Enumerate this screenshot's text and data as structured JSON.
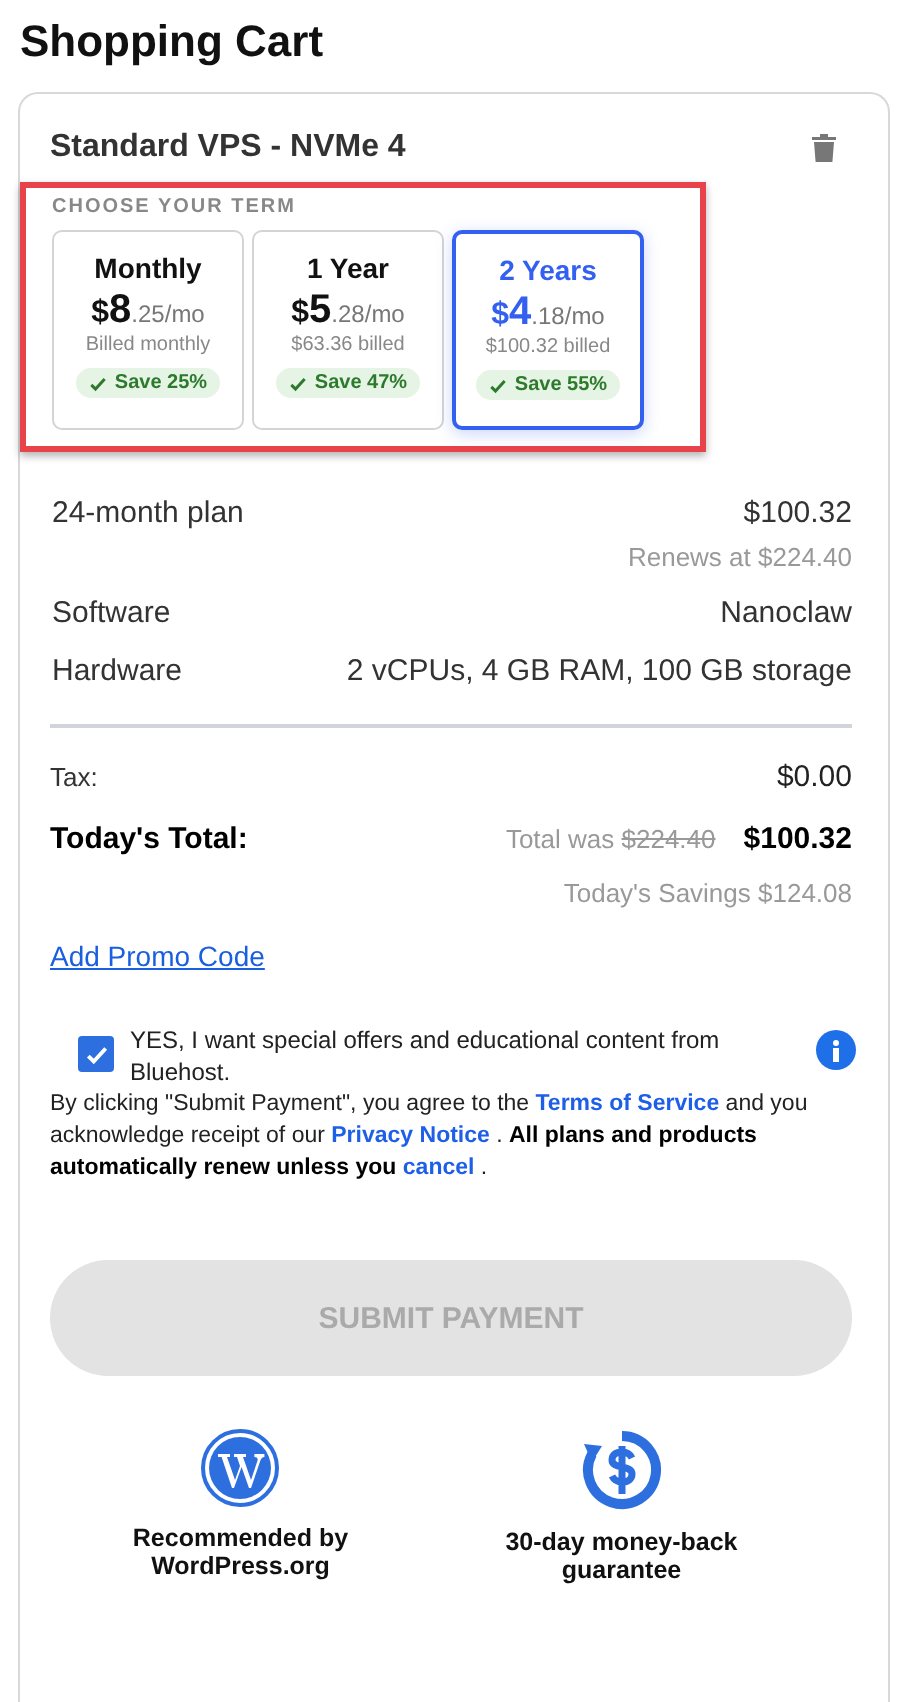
{
  "title": "Shopping Cart",
  "item": {
    "name": "Standard VPS - NVMe 4",
    "term_heading": "CHOOSE YOUR TERM",
    "terms": [
      {
        "label": "Monthly",
        "currency": "$",
        "whole": "8",
        "fraction": ".25/mo",
        "billed": "Billed monthly",
        "save": "Save 25%",
        "selected": false
      },
      {
        "label": "1 Year",
        "currency": "$",
        "whole": "5",
        "fraction": ".28/mo",
        "billed": "$63.36 billed",
        "save": "Save 47%",
        "selected": false
      },
      {
        "label": "2 Years",
        "currency": "$",
        "whole": "4",
        "fraction": ".18/mo",
        "billed": "$100.32 billed",
        "save": "Save 55%",
        "selected": true
      }
    ],
    "details": [
      {
        "label": "24-month plan",
        "value": "$100.32",
        "note": "Renews at $224.40"
      },
      {
        "label": "Software",
        "value": "Nanoclaw"
      },
      {
        "label": "Hardware",
        "value": "2 vCPUs, 4 GB RAM, 100 GB storage"
      }
    ]
  },
  "tax": {
    "label": "Tax:",
    "value": "$0.00"
  },
  "total": {
    "label": "Today's Total:",
    "was_label": "Total was",
    "was_value": "$224.40",
    "value": "$100.32",
    "savings": "Today's Savings $124.08"
  },
  "promo_link": "Add Promo Code",
  "offers": {
    "checked": true,
    "label": "YES, I want special offers and educational content from Bluehost."
  },
  "legal": [
    {
      "kind": "plain",
      "text": "By clicking \"Submit Payment\", you agree to the "
    },
    {
      "kind": "link",
      "text": "Terms of Service"
    },
    {
      "kind": "plain",
      "text": " and you acknowledge receipt of our "
    },
    {
      "kind": "link",
      "text": "Privacy Notice"
    },
    {
      "kind": "plain",
      "text": " . "
    },
    {
      "kind": "bold",
      "text": "All plans and products automatically renew unless you "
    },
    {
      "kind": "link",
      "text": "cancel"
    },
    {
      "kind": "plain",
      "text": " ."
    }
  ],
  "submit": {
    "label": "SUBMIT PAYMENT",
    "disabled": true
  },
  "badges": [
    {
      "kind": "wordpress",
      "text": "Recommended by WordPress.org"
    },
    {
      "kind": "money",
      "text": "30-day money-back guarantee"
    }
  ]
}
